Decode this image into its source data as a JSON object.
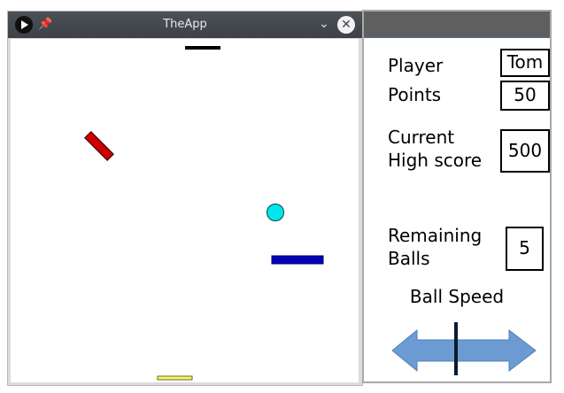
{
  "window": {
    "title": "TheApp",
    "pin_icon": "pin-icon",
    "play_icon": "play-icon",
    "chevron_icon": "chevron-down-icon",
    "close_icon": "close-icon"
  },
  "game": {
    "ball_color": "#00e5ee",
    "top_paddle_color": "#000000",
    "bottom_paddle_color": "#f5f57a",
    "red_obstacle_color": "#cc0000",
    "blue_block_color": "#0000bb"
  },
  "panel": {
    "player_label": "Player",
    "player_value": "Tom",
    "points_label": "Points",
    "points_value": "50",
    "highscore_label_line1": "Current",
    "highscore_label_line2": "High score",
    "highscore_value": "500",
    "balls_label_line1": "Remaining",
    "balls_label_line2": "Balls",
    "balls_value": "5",
    "speed_label": "Ball Speed",
    "speed_slider_color": "#6b9bd2"
  }
}
